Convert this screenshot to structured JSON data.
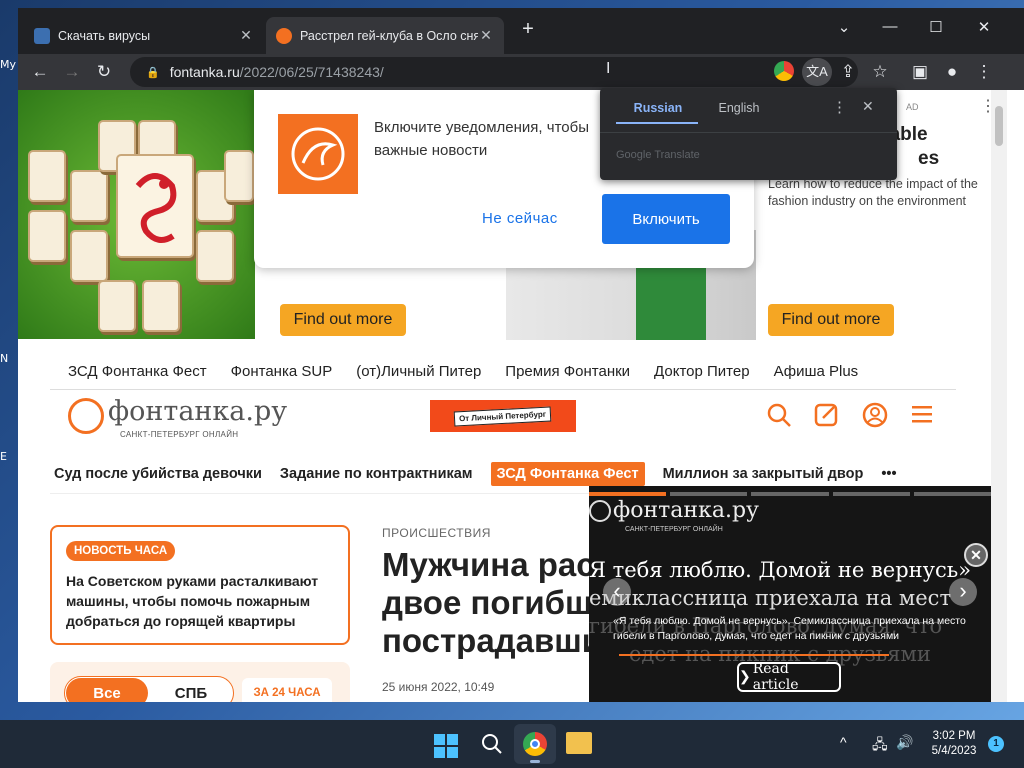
{
  "desktop": {
    "labels": [
      "My",
      "N",
      "E"
    ]
  },
  "tabs": [
    {
      "title": "Скачать вирусы",
      "active": false
    },
    {
      "title": "Расстрел гей-клуба в Осло снял",
      "active": true
    }
  ],
  "window_controls": {
    "tab_search": "⌄",
    "minimize": "—",
    "maximize": "☐",
    "close": "✕"
  },
  "address": {
    "domain": "fontanka.ru",
    "path": "/2022/06/25/71438243/"
  },
  "translate_popup": {
    "lang_from": "Russian",
    "lang_to": "English",
    "provider": "Google Translate"
  },
  "notification": {
    "text": "Включите уведомления, чтобы не пропустить важные новости",
    "text_visible": "Включите уведомления, чтобы\nважные новости",
    "not_now": "Не сейчас",
    "enable": "Включить"
  },
  "ads": {
    "find_out_more": "Find out more",
    "right_title_visible": "nable",
    "right_title2_visible": "es",
    "right_tag": "AD",
    "right_body": "Learn how to reduce the impact of the fashion industry on the environment"
  },
  "top_nav": [
    "ЗСД Фонтанка Фест",
    "Фонтанка SUP",
    "(от)Личный Питер",
    "Премия Фонтанки",
    "Доктор Питер",
    "Афиша Plus"
  ],
  "site": {
    "logo_text": "фонтанка.ру",
    "logo_sub": "САНКТ-ПЕТЕРБУРГ ОНЛАЙН",
    "banner_text": "От Личный Петербург"
  },
  "cat_nav": [
    "Суд после убийства девочки",
    "Задание по контрактникам",
    "ЗСД Фонтанка Фест",
    "Миллион за закрытый двор",
    "•••"
  ],
  "news_hour": {
    "badge": "НОВОСТЬ ЧАСА",
    "text": "На Советском руками расталкивают машины, чтобы помочь пожарным добраться до горящей квартиры"
  },
  "filter": {
    "all": "Все",
    "spb": "СПБ",
    "h24": "ЗА 24 ЧАСА"
  },
  "article": {
    "category": "ПРОИСШЕСТВИЯ",
    "headline_lines": [
      "Мужчина рас",
      "двое погибши",
      "пострадавши"
    ],
    "date": "25 июня 2022, 10:49"
  },
  "video": {
    "logo": "фонтанка.ру",
    "logo_sub": "САНКТ-ПЕТЕРБУРГ ОНЛАЙН",
    "big_line1": "Я тебя люблю. Домой не вернусь»",
    "big_line2": "емиклассница приехала на мест",
    "big_line3": "гибели в Парголово, думая, что",
    "big_line4": "едет на пикник с друзьями",
    "caption": "«Я тебя люблю. Домой не вернусь». Семиклассница приехала на место гибели в Парголово, думая, что едет на пикник с друзьями",
    "read": "Read article",
    "prev": "‹",
    "next": "›",
    "close": "✕"
  },
  "taskbar": {
    "time": "3:02 PM",
    "date": "5/4/2023",
    "notif_count": "1"
  },
  "colors": {
    "brand": "#f37021",
    "blue": "#1a73e8",
    "dark": "#202124"
  }
}
